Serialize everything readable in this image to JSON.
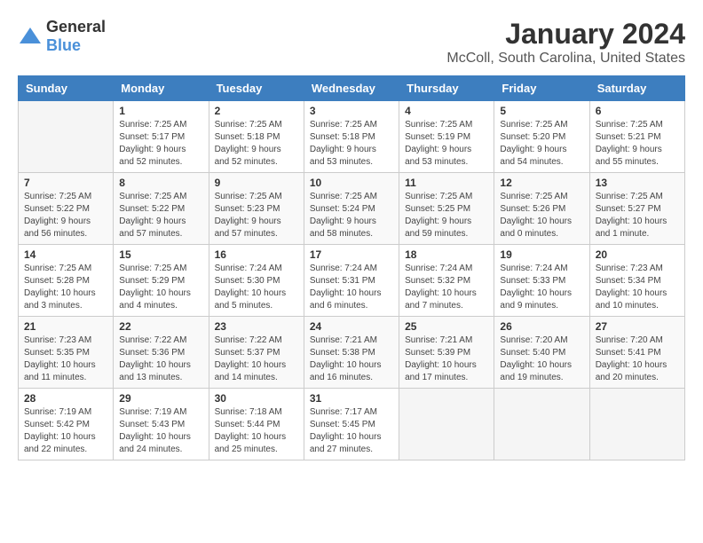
{
  "logo": {
    "general": "General",
    "blue": "Blue"
  },
  "header": {
    "title": "January 2024",
    "subtitle": "McColl, South Carolina, United States"
  },
  "weekdays": [
    "Sunday",
    "Monday",
    "Tuesday",
    "Wednesday",
    "Thursday",
    "Friday",
    "Saturday"
  ],
  "weeks": [
    [
      {
        "day": "",
        "empty": true
      },
      {
        "day": "1",
        "sunrise": "Sunrise: 7:25 AM",
        "sunset": "Sunset: 5:17 PM",
        "daylight": "Daylight: 9 hours and 52 minutes."
      },
      {
        "day": "2",
        "sunrise": "Sunrise: 7:25 AM",
        "sunset": "Sunset: 5:18 PM",
        "daylight": "Daylight: 9 hours and 52 minutes."
      },
      {
        "day": "3",
        "sunrise": "Sunrise: 7:25 AM",
        "sunset": "Sunset: 5:18 PM",
        "daylight": "Daylight: 9 hours and 53 minutes."
      },
      {
        "day": "4",
        "sunrise": "Sunrise: 7:25 AM",
        "sunset": "Sunset: 5:19 PM",
        "daylight": "Daylight: 9 hours and 53 minutes."
      },
      {
        "day": "5",
        "sunrise": "Sunrise: 7:25 AM",
        "sunset": "Sunset: 5:20 PM",
        "daylight": "Daylight: 9 hours and 54 minutes."
      },
      {
        "day": "6",
        "sunrise": "Sunrise: 7:25 AM",
        "sunset": "Sunset: 5:21 PM",
        "daylight": "Daylight: 9 hours and 55 minutes."
      }
    ],
    [
      {
        "day": "7",
        "sunrise": "Sunrise: 7:25 AM",
        "sunset": "Sunset: 5:22 PM",
        "daylight": "Daylight: 9 hours and 56 minutes."
      },
      {
        "day": "8",
        "sunrise": "Sunrise: 7:25 AM",
        "sunset": "Sunset: 5:22 PM",
        "daylight": "Daylight: 9 hours and 57 minutes."
      },
      {
        "day": "9",
        "sunrise": "Sunrise: 7:25 AM",
        "sunset": "Sunset: 5:23 PM",
        "daylight": "Daylight: 9 hours and 57 minutes."
      },
      {
        "day": "10",
        "sunrise": "Sunrise: 7:25 AM",
        "sunset": "Sunset: 5:24 PM",
        "daylight": "Daylight: 9 hours and 58 minutes."
      },
      {
        "day": "11",
        "sunrise": "Sunrise: 7:25 AM",
        "sunset": "Sunset: 5:25 PM",
        "daylight": "Daylight: 9 hours and 59 minutes."
      },
      {
        "day": "12",
        "sunrise": "Sunrise: 7:25 AM",
        "sunset": "Sunset: 5:26 PM",
        "daylight": "Daylight: 10 hours and 0 minutes."
      },
      {
        "day": "13",
        "sunrise": "Sunrise: 7:25 AM",
        "sunset": "Sunset: 5:27 PM",
        "daylight": "Daylight: 10 hours and 1 minute."
      }
    ],
    [
      {
        "day": "14",
        "sunrise": "Sunrise: 7:25 AM",
        "sunset": "Sunset: 5:28 PM",
        "daylight": "Daylight: 10 hours and 3 minutes."
      },
      {
        "day": "15",
        "sunrise": "Sunrise: 7:25 AM",
        "sunset": "Sunset: 5:29 PM",
        "daylight": "Daylight: 10 hours and 4 minutes."
      },
      {
        "day": "16",
        "sunrise": "Sunrise: 7:24 AM",
        "sunset": "Sunset: 5:30 PM",
        "daylight": "Daylight: 10 hours and 5 minutes."
      },
      {
        "day": "17",
        "sunrise": "Sunrise: 7:24 AM",
        "sunset": "Sunset: 5:31 PM",
        "daylight": "Daylight: 10 hours and 6 minutes."
      },
      {
        "day": "18",
        "sunrise": "Sunrise: 7:24 AM",
        "sunset": "Sunset: 5:32 PM",
        "daylight": "Daylight: 10 hours and 7 minutes."
      },
      {
        "day": "19",
        "sunrise": "Sunrise: 7:24 AM",
        "sunset": "Sunset: 5:33 PM",
        "daylight": "Daylight: 10 hours and 9 minutes."
      },
      {
        "day": "20",
        "sunrise": "Sunrise: 7:23 AM",
        "sunset": "Sunset: 5:34 PM",
        "daylight": "Daylight: 10 hours and 10 minutes."
      }
    ],
    [
      {
        "day": "21",
        "sunrise": "Sunrise: 7:23 AM",
        "sunset": "Sunset: 5:35 PM",
        "daylight": "Daylight: 10 hours and 11 minutes."
      },
      {
        "day": "22",
        "sunrise": "Sunrise: 7:22 AM",
        "sunset": "Sunset: 5:36 PM",
        "daylight": "Daylight: 10 hours and 13 minutes."
      },
      {
        "day": "23",
        "sunrise": "Sunrise: 7:22 AM",
        "sunset": "Sunset: 5:37 PM",
        "daylight": "Daylight: 10 hours and 14 minutes."
      },
      {
        "day": "24",
        "sunrise": "Sunrise: 7:21 AM",
        "sunset": "Sunset: 5:38 PM",
        "daylight": "Daylight: 10 hours and 16 minutes."
      },
      {
        "day": "25",
        "sunrise": "Sunrise: 7:21 AM",
        "sunset": "Sunset: 5:39 PM",
        "daylight": "Daylight: 10 hours and 17 minutes."
      },
      {
        "day": "26",
        "sunrise": "Sunrise: 7:20 AM",
        "sunset": "Sunset: 5:40 PM",
        "daylight": "Daylight: 10 hours and 19 minutes."
      },
      {
        "day": "27",
        "sunrise": "Sunrise: 7:20 AM",
        "sunset": "Sunset: 5:41 PM",
        "daylight": "Daylight: 10 hours and 20 minutes."
      }
    ],
    [
      {
        "day": "28",
        "sunrise": "Sunrise: 7:19 AM",
        "sunset": "Sunset: 5:42 PM",
        "daylight": "Daylight: 10 hours and 22 minutes."
      },
      {
        "day": "29",
        "sunrise": "Sunrise: 7:19 AM",
        "sunset": "Sunset: 5:43 PM",
        "daylight": "Daylight: 10 hours and 24 minutes."
      },
      {
        "day": "30",
        "sunrise": "Sunrise: 7:18 AM",
        "sunset": "Sunset: 5:44 PM",
        "daylight": "Daylight: 10 hours and 25 minutes."
      },
      {
        "day": "31",
        "sunrise": "Sunrise: 7:17 AM",
        "sunset": "Sunset: 5:45 PM",
        "daylight": "Daylight: 10 hours and 27 minutes."
      },
      {
        "day": "",
        "empty": true
      },
      {
        "day": "",
        "empty": true
      },
      {
        "day": "",
        "empty": true
      }
    ]
  ]
}
